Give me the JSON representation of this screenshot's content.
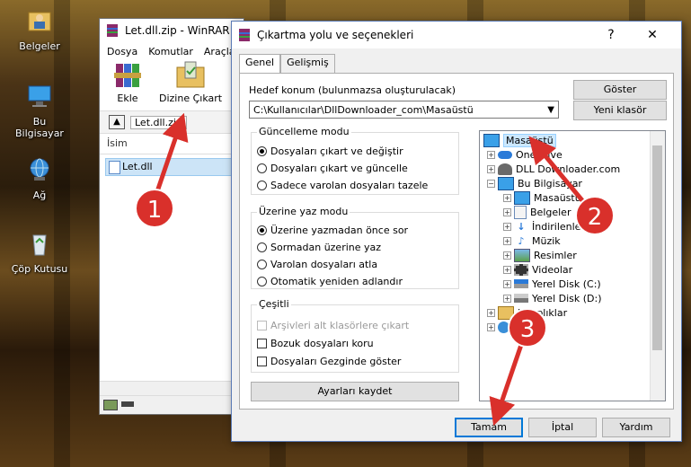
{
  "desktop": {
    "icons": [
      {
        "label": "Belgeler"
      },
      {
        "label": "Bu Bilgisayar"
      },
      {
        "label": "Ağ"
      },
      {
        "label": "Çöp Kutusu"
      }
    ]
  },
  "winrar": {
    "title": "Let.dll.zip - WinRAR",
    "menu": [
      "Dosya",
      "Komutlar",
      "Araçla"
    ],
    "toolbar": {
      "add": "Ekle",
      "extract": "Dizine Çıkart"
    },
    "path": "Let.dll.zip",
    "column_name": "İsim",
    "file": "Let.dll"
  },
  "dialog": {
    "title": "Çıkartma yolu ve seçenekleri",
    "help_glyph": "?",
    "close_glyph": "✕",
    "tabs": [
      "Genel",
      "Gelişmiş"
    ],
    "dest_label": "Hedef konum (bulunmazsa oluşturulacak)",
    "dest_path": "C:\\Kullanıcılar\\DllDownloader_com\\Masaüstü",
    "show_button": "Göster",
    "new_folder_button": "Yeni klasör",
    "update_mode": {
      "title": "Güncelleme modu",
      "options": [
        "Dosyaları çıkart ve değiştir",
        "Dosyaları çıkart ve güncelle",
        "Sadece varolan dosyaları tazele"
      ],
      "selected": 0
    },
    "overwrite_mode": {
      "title": "Üzerine yaz modu",
      "options": [
        "Üzerine yazmadan önce sor",
        "Sormadan üzerine yaz",
        "Varolan dosyaları atla",
        "Otomatik yeniden adlandır"
      ],
      "selected": 0
    },
    "misc": {
      "title": "Çeşitli",
      "options": [
        {
          "label": "Arşivleri alt klasörlere çıkart",
          "checked": false,
          "disabled": true
        },
        {
          "label": "Bozuk dosyaları koru",
          "checked": false,
          "disabled": false
        },
        {
          "label": "Dosyaları Gezginde göster",
          "checked": false,
          "disabled": false
        }
      ]
    },
    "save_settings_button": "Ayarları kaydet",
    "tree": [
      {
        "label": "Masaüstü",
        "selected": true
      },
      {
        "label": "OneDrive"
      },
      {
        "label": "DLL Downloader.com"
      },
      {
        "label": "Bu Bilgisayar"
      },
      {
        "label": "Masaüstü"
      },
      {
        "label": "Belgeler"
      },
      {
        "label": "İndirilenler"
      },
      {
        "label": "Müzik"
      },
      {
        "label": "Resimler"
      },
      {
        "label": "Videolar"
      },
      {
        "label": "Yerel Disk (C:)"
      },
      {
        "label": "Yerel Disk (D:)"
      },
      {
        "label": "Kitaplıklar"
      },
      {
        "label": "Ağ"
      }
    ],
    "ok_button": "Tamam",
    "cancel_button": "İptal",
    "help_button": "Yardım"
  },
  "annotations": {
    "step1": "1",
    "step2": "2",
    "step3": "3"
  },
  "colors": {
    "accent": "#0078d7",
    "badge": "#d9302b",
    "selection": "#cce8ff"
  }
}
